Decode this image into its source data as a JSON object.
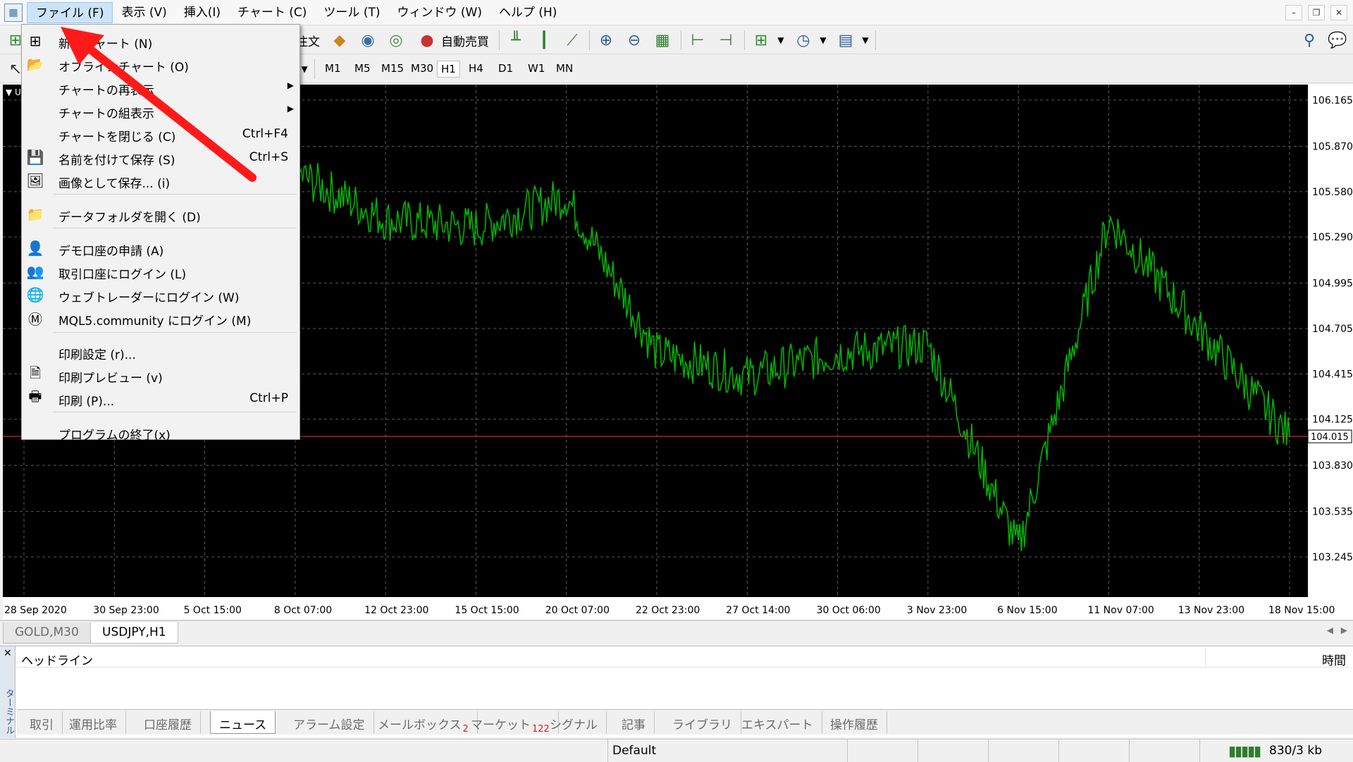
{
  "menubar": {
    "items": [
      "ファイル (F)",
      "表示 (V)",
      "挿入(I)",
      "チャート (C)",
      "ツール (T)",
      "ウィンドウ (W)",
      "ヘルプ (H)"
    ]
  },
  "toolbar1": {
    "order_label": "注文",
    "autotrade_label": "自動売買"
  },
  "toolbar2": {
    "timeframes": [
      "M1",
      "M5",
      "M15",
      "M30",
      "H1",
      "H4",
      "D1",
      "W1",
      "MN"
    ],
    "active_timeframe": "H1"
  },
  "file_menu": {
    "items": [
      {
        "label": "新規チャート (N)",
        "shortcut": "",
        "icon": "new-chart-icon"
      },
      {
        "label": "オフラインチャート (O)",
        "shortcut": "",
        "icon": "folder-open-icon"
      },
      {
        "label": "チャートの再表示",
        "shortcut": "",
        "submenu": true
      },
      {
        "label": "チャートの組表示",
        "shortcut": "",
        "submenu": true
      },
      {
        "label": "チャートを閉じる (C)",
        "shortcut": "Ctrl+F4"
      },
      {
        "label": "名前を付けて保存 (S)",
        "shortcut": "Ctrl+S",
        "icon": "save-icon"
      },
      {
        "label": "画像として保存... (i)",
        "shortcut": "",
        "icon": "save-image-icon"
      },
      {
        "label": "データフォルダを開く (D)",
        "shortcut": "",
        "icon": "folder-icon"
      },
      {
        "label": "デモ口座の申請 (A)",
        "shortcut": "",
        "icon": "demo-account-icon"
      },
      {
        "label": "取引口座にログイン (L)",
        "shortcut": "",
        "icon": "login-icon"
      },
      {
        "label": "ウェブトレーダーにログイン (W)",
        "shortcut": "",
        "icon": "web-trader-icon"
      },
      {
        "label": "MQL5.community にログイン (M)",
        "shortcut": "",
        "icon": "mql5-icon"
      },
      {
        "label": "印刷設定 (r)...",
        "shortcut": ""
      },
      {
        "label": "印刷プレビュー (v)",
        "shortcut": "",
        "icon": "print-preview-icon"
      },
      {
        "label": "印刷 (P)...",
        "shortcut": "Ctrl+P",
        "icon": "print-icon"
      },
      {
        "label": "プログラムの終了(x)",
        "shortcut": ""
      }
    ]
  },
  "chart": {
    "symbol_short": "U",
    "price_labels": [
      "106.165",
      "105.870",
      "105.580",
      "105.290",
      "104.995",
      "104.705",
      "104.415",
      "104.125",
      "103.830",
      "103.535",
      "103.245"
    ],
    "current_price": "104.015",
    "time_labels": [
      "28 Sep 2020",
      "30 Sep 23:00",
      "5 Oct 15:00",
      "8 Oct 07:00",
      "12 Oct 23:00",
      "15 Oct 15:00",
      "20 Oct 07:00",
      "22 Oct 23:00",
      "27 Oct 14:00",
      "30 Oct 06:00",
      "3 Nov 23:00",
      "6 Nov 15:00",
      "11 Nov 07:00",
      "13 Nov 23:00",
      "18 Nov 15:00"
    ],
    "line_color": "#00b400",
    "current_line_color": "#e02020",
    "price_path": [
      [
        "28 Sep 2020",
        104.95
      ],
      [
        "30 Sep 23:00",
        105.75
      ],
      [
        "5 Oct 15:00",
        105.9
      ],
      [
        "8 Oct 07:00",
        105.7
      ],
      [
        "12 Oct 23:00",
        105.4
      ],
      [
        "15 Oct 15:00",
        105.35
      ],
      [
        "20 Oct 07:00",
        105.55
      ],
      [
        "22 Oct 23:00",
        104.55
      ],
      [
        "27 Oct 14:00",
        104.4
      ],
      [
        "30 Oct 06:00",
        104.55
      ],
      [
        "3 Nov 23:00",
        104.6
      ],
      [
        "6 Nov 15:00",
        103.3
      ],
      [
        "11 Nov 07:00",
        105.4
      ],
      [
        "13 Nov 23:00",
        104.7
      ],
      [
        "18 Nov 15:00",
        104.01
      ]
    ]
  },
  "chart_tabs": [
    "GOLD,M30",
    "USDJPY,H1"
  ],
  "active_chart_tab": "USDJPY,H1",
  "terminal": {
    "side_label": "ターミナル",
    "headline_col": "ヘッドライン",
    "time_col": "時間",
    "tabs": [
      {
        "label": "取引"
      },
      {
        "label": "運用比率"
      },
      {
        "label": "口座履歴"
      },
      {
        "label": "ニュース",
        "active": true
      },
      {
        "label": "アラーム設定"
      },
      {
        "label": "メールボックス",
        "badge": "2"
      },
      {
        "label": "マーケット",
        "badge": "122"
      },
      {
        "label": "シグナル"
      },
      {
        "label": "記事"
      },
      {
        "label": "ライブラリ"
      },
      {
        "label": "エキスパート"
      },
      {
        "label": "操作履歴"
      }
    ]
  },
  "statusbar": {
    "profile": "Default",
    "traffic": "830/3 kb"
  }
}
